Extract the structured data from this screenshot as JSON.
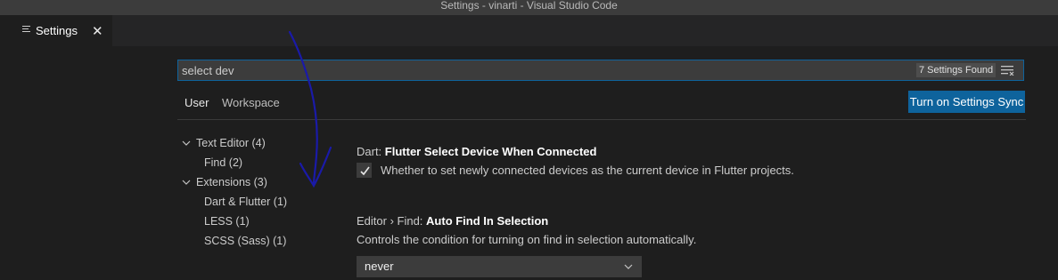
{
  "window": {
    "title": "Settings - vinarti - Visual Studio Code"
  },
  "tab": {
    "label": "Settings",
    "close": "✕"
  },
  "search": {
    "value": "select dev",
    "results_badge": "7 Settings Found"
  },
  "scopes": {
    "user": "User",
    "workspace": "Workspace",
    "active": "User"
  },
  "sync_button": "Turn on Settings Sync",
  "toc": [
    {
      "label": "Text Editor (4)",
      "expanded": true
    },
    {
      "label": "Find (2)"
    },
    {
      "label": "Extensions (3)",
      "expanded": true
    },
    {
      "label": "Dart & Flutter (1)"
    },
    {
      "label": "LESS (1)"
    },
    {
      "label": "SCSS (Sass) (1)"
    }
  ],
  "settings": [
    {
      "category": "Dart: ",
      "name": "Flutter Select Device When Connected",
      "description": "Whether to set newly connected devices as the current device in Flutter projects.",
      "checked": true
    },
    {
      "category": "Editor › Find: ",
      "name": "Auto Find In Selection",
      "description": "Controls the condition for turning on find in selection automatically.",
      "value": "never"
    }
  ],
  "colors": {
    "accent": "#0e639c",
    "annotation_ink": "#1a1aa8"
  }
}
